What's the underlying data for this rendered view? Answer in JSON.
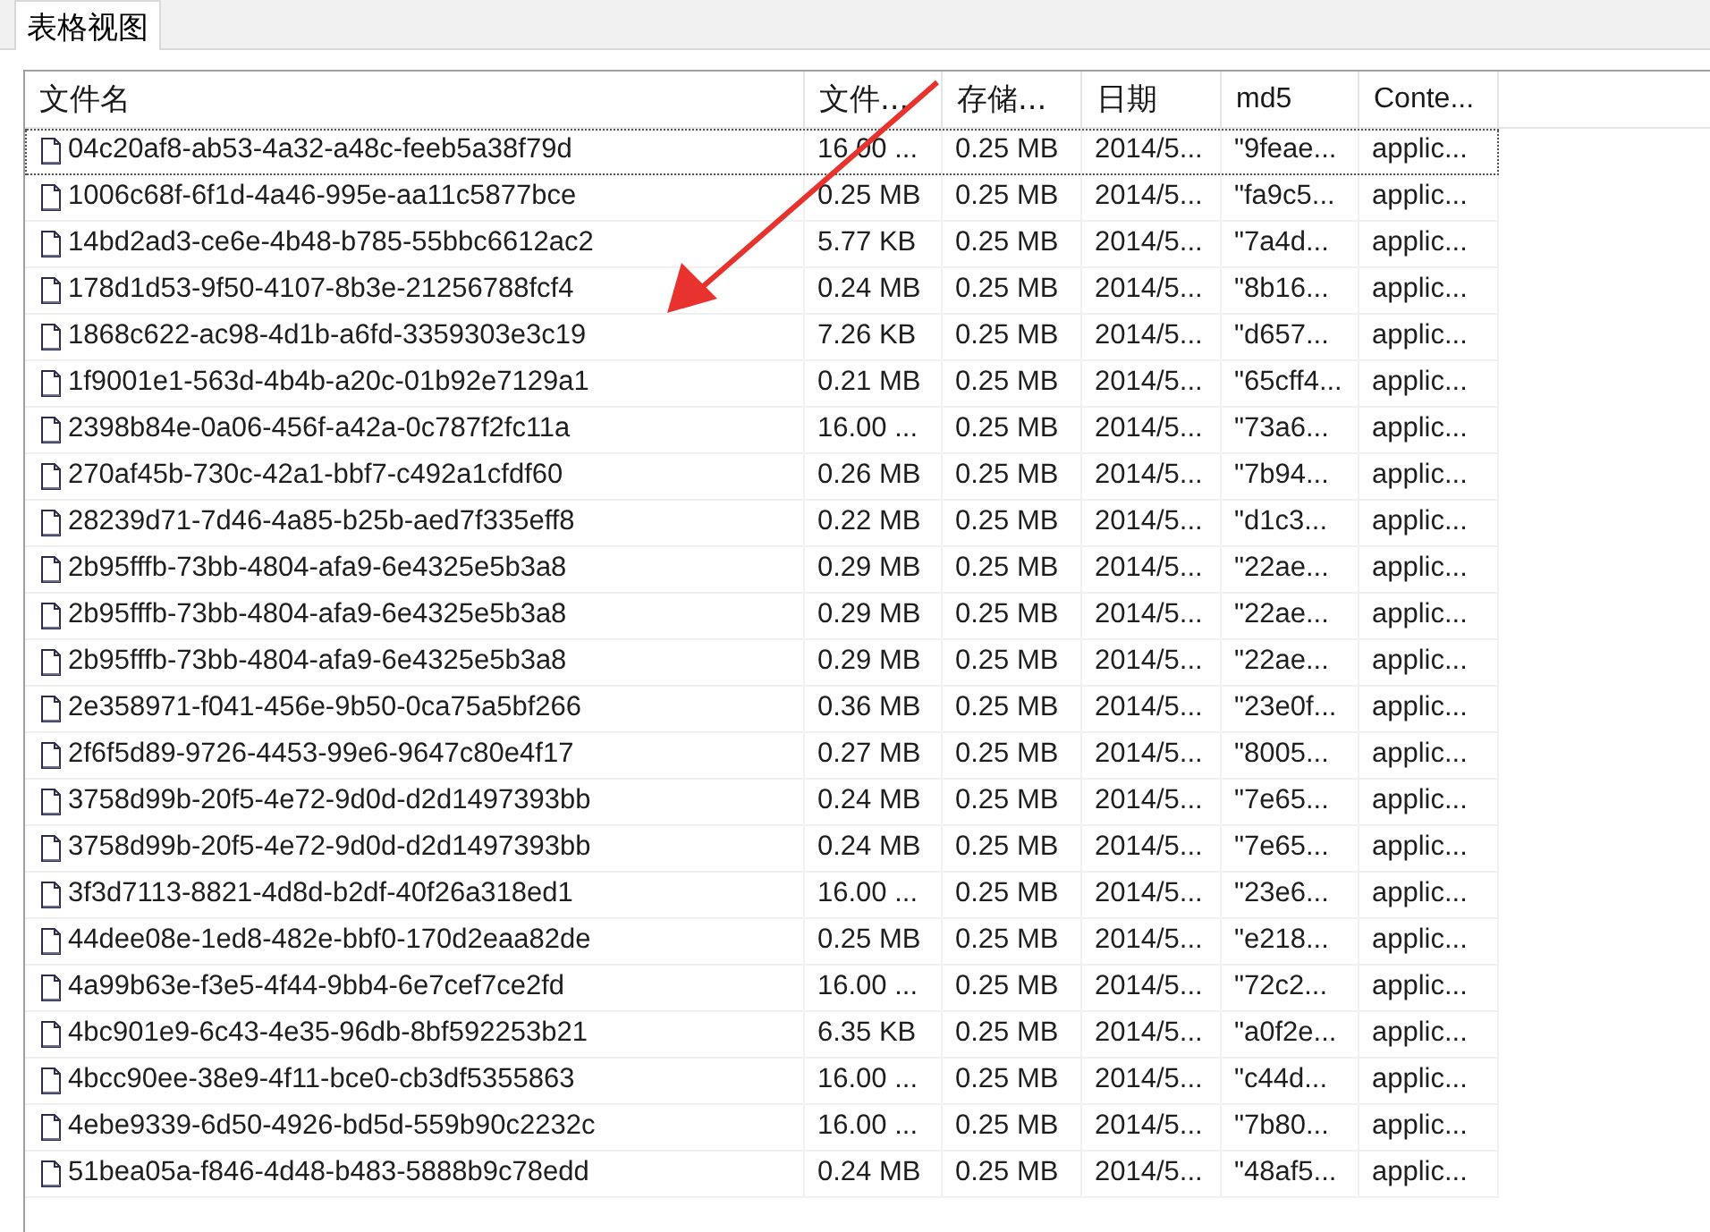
{
  "tabs": [
    {
      "label": "表格视图",
      "selected": true
    }
  ],
  "table": {
    "columns": [
      "文件名",
      "文件...",
      "存储...",
      "日期",
      "md5",
      "Conte..."
    ],
    "rows": [
      {
        "focused": true,
        "cells": [
          "04c20af8-ab53-4a32-a48c-feeb5a38f79d",
          "16.00 ...",
          "0.25 MB",
          "2014/5...",
          "\"9feae...",
          "applic..."
        ]
      },
      {
        "focused": false,
        "cells": [
          "1006c68f-6f1d-4a46-995e-aa11c5877bce",
          "0.25 MB",
          "0.25 MB",
          "2014/5...",
          "\"fa9c5...",
          "applic..."
        ]
      },
      {
        "focused": false,
        "cells": [
          "14bd2ad3-ce6e-4b48-b785-55bbc6612ac2",
          "5.77 KB",
          "0.25 MB",
          "2014/5...",
          "\"7a4d...",
          "applic..."
        ]
      },
      {
        "focused": false,
        "cells": [
          "178d1d53-9f50-4107-8b3e-21256788fcf4",
          "0.24 MB",
          "0.25 MB",
          "2014/5...",
          "\"8b16...",
          "applic..."
        ]
      },
      {
        "focused": false,
        "cells": [
          "1868c622-ac98-4d1b-a6fd-3359303e3c19",
          "7.26 KB",
          "0.25 MB",
          "2014/5...",
          "\"d657...",
          "applic..."
        ]
      },
      {
        "focused": false,
        "cells": [
          "1f9001e1-563d-4b4b-a20c-01b92e7129a1",
          "0.21 MB",
          "0.25 MB",
          "2014/5...",
          "\"65cff4...",
          "applic..."
        ]
      },
      {
        "focused": false,
        "cells": [
          "2398b84e-0a06-456f-a42a-0c787f2fc11a",
          "16.00 ...",
          "0.25 MB",
          "2014/5...",
          "\"73a6...",
          "applic..."
        ]
      },
      {
        "focused": false,
        "cells": [
          "270af45b-730c-42a1-bbf7-c492a1cfdf60",
          "0.26 MB",
          "0.25 MB",
          "2014/5...",
          "\"7b94...",
          "applic..."
        ]
      },
      {
        "focused": false,
        "cells": [
          "28239d71-7d46-4a85-b25b-aed7f335eff8",
          "0.22 MB",
          "0.25 MB",
          "2014/5...",
          "\"d1c3...",
          "applic..."
        ]
      },
      {
        "focused": false,
        "cells": [
          "2b95fffb-73bb-4804-afa9-6e4325e5b3a8",
          "0.29 MB",
          "0.25 MB",
          "2014/5...",
          "\"22ae...",
          "applic..."
        ]
      },
      {
        "focused": false,
        "cells": [
          "2b95fffb-73bb-4804-afa9-6e4325e5b3a8",
          "0.29 MB",
          "0.25 MB",
          "2014/5...",
          "\"22ae...",
          "applic..."
        ]
      },
      {
        "focused": false,
        "cells": [
          "2b95fffb-73bb-4804-afa9-6e4325e5b3a8",
          "0.29 MB",
          "0.25 MB",
          "2014/5...",
          "\"22ae...",
          "applic..."
        ]
      },
      {
        "focused": false,
        "cells": [
          "2e358971-f041-456e-9b50-0ca75a5bf266",
          "0.36 MB",
          "0.25 MB",
          "2014/5...",
          "\"23e0f...",
          "applic..."
        ]
      },
      {
        "focused": false,
        "cells": [
          "2f6f5d89-9726-4453-99e6-9647c80e4f17",
          "0.27 MB",
          "0.25 MB",
          "2014/5...",
          "\"8005...",
          "applic..."
        ]
      },
      {
        "focused": false,
        "cells": [
          "3758d99b-20f5-4e72-9d0d-d2d1497393bb",
          "0.24 MB",
          "0.25 MB",
          "2014/5...",
          "\"7e65...",
          "applic..."
        ]
      },
      {
        "focused": false,
        "cells": [
          "3758d99b-20f5-4e72-9d0d-d2d1497393bb",
          "0.24 MB",
          "0.25 MB",
          "2014/5...",
          "\"7e65...",
          "applic..."
        ]
      },
      {
        "focused": false,
        "cells": [
          "3f3d7113-8821-4d8d-b2df-40f26a318ed1",
          "16.00 ...",
          "0.25 MB",
          "2014/5...",
          "\"23e6...",
          "applic..."
        ]
      },
      {
        "focused": false,
        "cells": [
          "44dee08e-1ed8-482e-bbf0-170d2eaa82de",
          "0.25 MB",
          "0.25 MB",
          "2014/5...",
          "\"e218...",
          "applic..."
        ]
      },
      {
        "focused": false,
        "cells": [
          "4a99b63e-f3e5-4f44-9bb4-6e7cef7ce2fd",
          "16.00 ...",
          "0.25 MB",
          "2014/5...",
          "\"72c2...",
          "applic..."
        ]
      },
      {
        "focused": false,
        "cells": [
          "4bc901e9-6c43-4e35-96db-8bf592253b21",
          "6.35 KB",
          "0.25 MB",
          "2014/5...",
          "\"a0f2e...",
          "applic..."
        ]
      },
      {
        "focused": false,
        "cells": [
          "4bcc90ee-38e9-4f11-bce0-cb3df5355863",
          "16.00 ...",
          "0.25 MB",
          "2014/5...",
          "\"c44d...",
          "applic..."
        ]
      },
      {
        "focused": false,
        "cells": [
          "4ebe9339-6d50-4926-bd5d-559b90c2232c",
          "16.00 ...",
          "0.25 MB",
          "2014/5...",
          "\"7b80...",
          "applic..."
        ]
      },
      {
        "focused": false,
        "cells": [
          "51bea05a-f846-4d48-b483-5888b9c78edd",
          "0.24 MB",
          "0.25 MB",
          "2014/5...",
          "\"48af5...",
          "applic..."
        ]
      }
    ]
  },
  "annotation": {
    "kind": "arrow"
  }
}
